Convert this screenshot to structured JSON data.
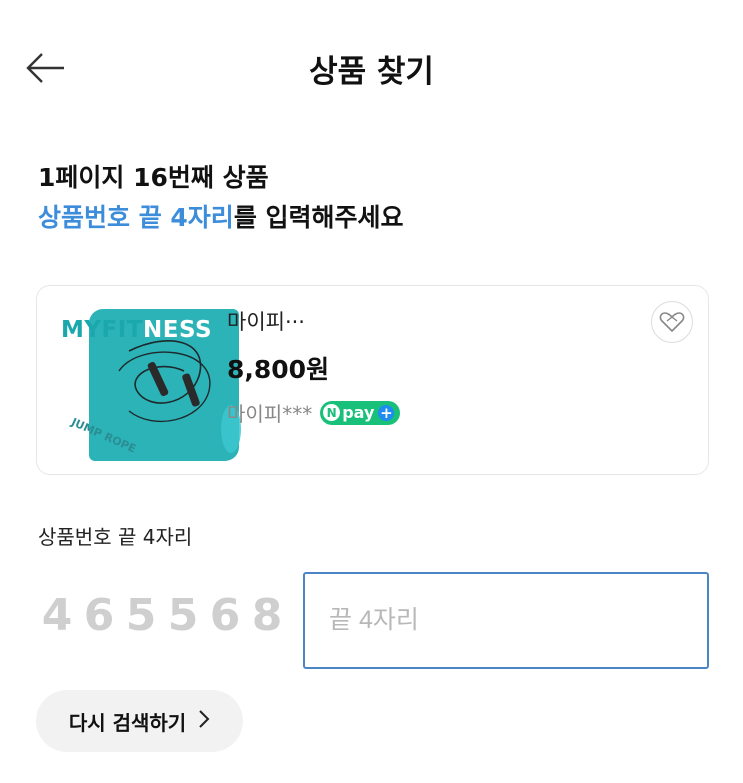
{
  "header": {
    "title": "상품 찾기"
  },
  "instruction": {
    "line1": "1페이지 16번째 상품",
    "line2_accent": "상품번호 끝 4자리",
    "line2_rest": "를 입력해주세요"
  },
  "product": {
    "image_brand_prefix": "MYFIT",
    "image_brand_suffix": "NESS",
    "image_caption": "JUMP ROPE",
    "name": "마이피···",
    "price": "8,800원",
    "seller": "마이피***",
    "npay_label": "pay"
  },
  "code_field": {
    "label": "상품번호 끝 4자리",
    "digits": [
      "4",
      "6",
      "5",
      "5",
      "6",
      "8"
    ],
    "placeholder": "끝 4자리",
    "value": ""
  },
  "retry": {
    "label": "다시 검색하기"
  },
  "colors": {
    "accent": "#3d8ddb",
    "input_border": "#4a86c5",
    "npay_green": "#19c07a",
    "product_teal": "#2bb3b8"
  }
}
